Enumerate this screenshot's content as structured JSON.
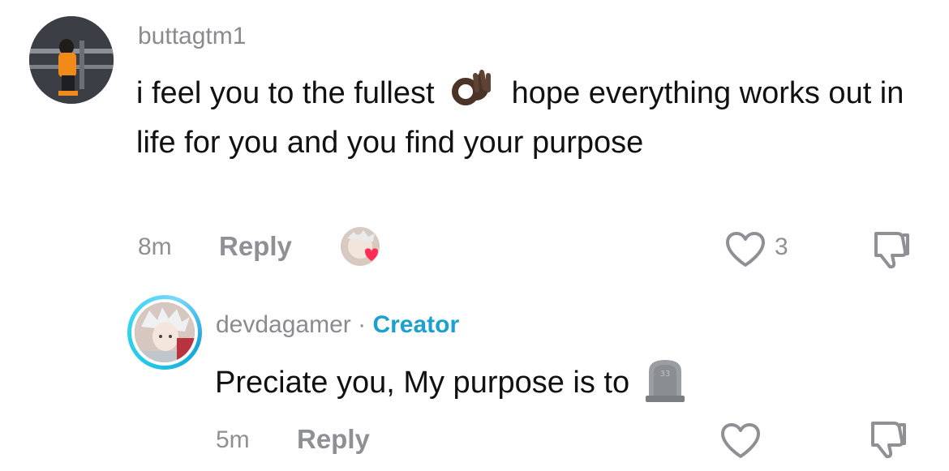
{
  "comments": [
    {
      "username": "buttagtm1",
      "text_part1": "i feel you to the fullest ",
      "emoji": "ok-hand",
      "text_part2": " hope everything works out in life for you and you find your purpose",
      "time": "8m",
      "reply_label": "Reply",
      "like_count": "3"
    },
    {
      "username": "devdagamer",
      "separator": "·",
      "badge": "Creator",
      "text": "Preciate you, My purpose is to",
      "emoji": "headstone",
      "time": "5m",
      "reply_label": "Reply"
    }
  ],
  "colors": {
    "username": "#8a8b91",
    "creator": "#1aa1cf",
    "heart": "#ff2d55",
    "text": "#111111"
  }
}
